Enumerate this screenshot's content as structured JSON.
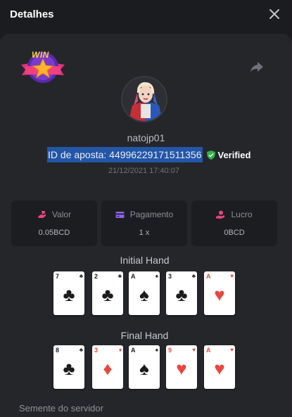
{
  "header": {
    "title": "Detalhes"
  },
  "bet": {
    "username": "natojp01",
    "id_text": "ID de aposta: 44996229171511356",
    "verified_label": "Verified",
    "timestamp": "21/12/2021 17:40:07",
    "badge_text": "WIN"
  },
  "stats": [
    {
      "label": "Valor",
      "value": "0.05BCD",
      "icon": "coin-hand-icon",
      "color": "#e8457b"
    },
    {
      "label": "Pagamento",
      "value": "1 x",
      "icon": "card-payment-icon",
      "color": "#8a63f0"
    },
    {
      "label": "Lucro",
      "value": "0BCD",
      "icon": "hand-coin-icon",
      "color": "#e8457b"
    }
  ],
  "initial_hand": {
    "title": "Initial Hand",
    "cards": [
      {
        "rank": "7",
        "suit": "♣",
        "color": "black"
      },
      {
        "rank": "2",
        "suit": "♣",
        "color": "black"
      },
      {
        "rank": "A",
        "suit": "♠",
        "color": "black"
      },
      {
        "rank": "3",
        "suit": "♣",
        "color": "black"
      },
      {
        "rank": "A",
        "suit": "♥",
        "color": "red"
      }
    ]
  },
  "final_hand": {
    "title": "Final Hand",
    "cards": [
      {
        "rank": "8",
        "suit": "♣",
        "color": "black"
      },
      {
        "rank": "3",
        "suit": "♦",
        "color": "red"
      },
      {
        "rank": "A",
        "suit": "♠",
        "color": "black"
      },
      {
        "rank": "9",
        "suit": "♥",
        "color": "red"
      },
      {
        "rank": "A",
        "suit": "♥",
        "color": "red"
      }
    ]
  },
  "server_seed": {
    "label": "Semente do servidor"
  },
  "colors": {
    "accent_green": "#2bb34b",
    "highlight": "#2456a8",
    "panel": "#25262a"
  }
}
